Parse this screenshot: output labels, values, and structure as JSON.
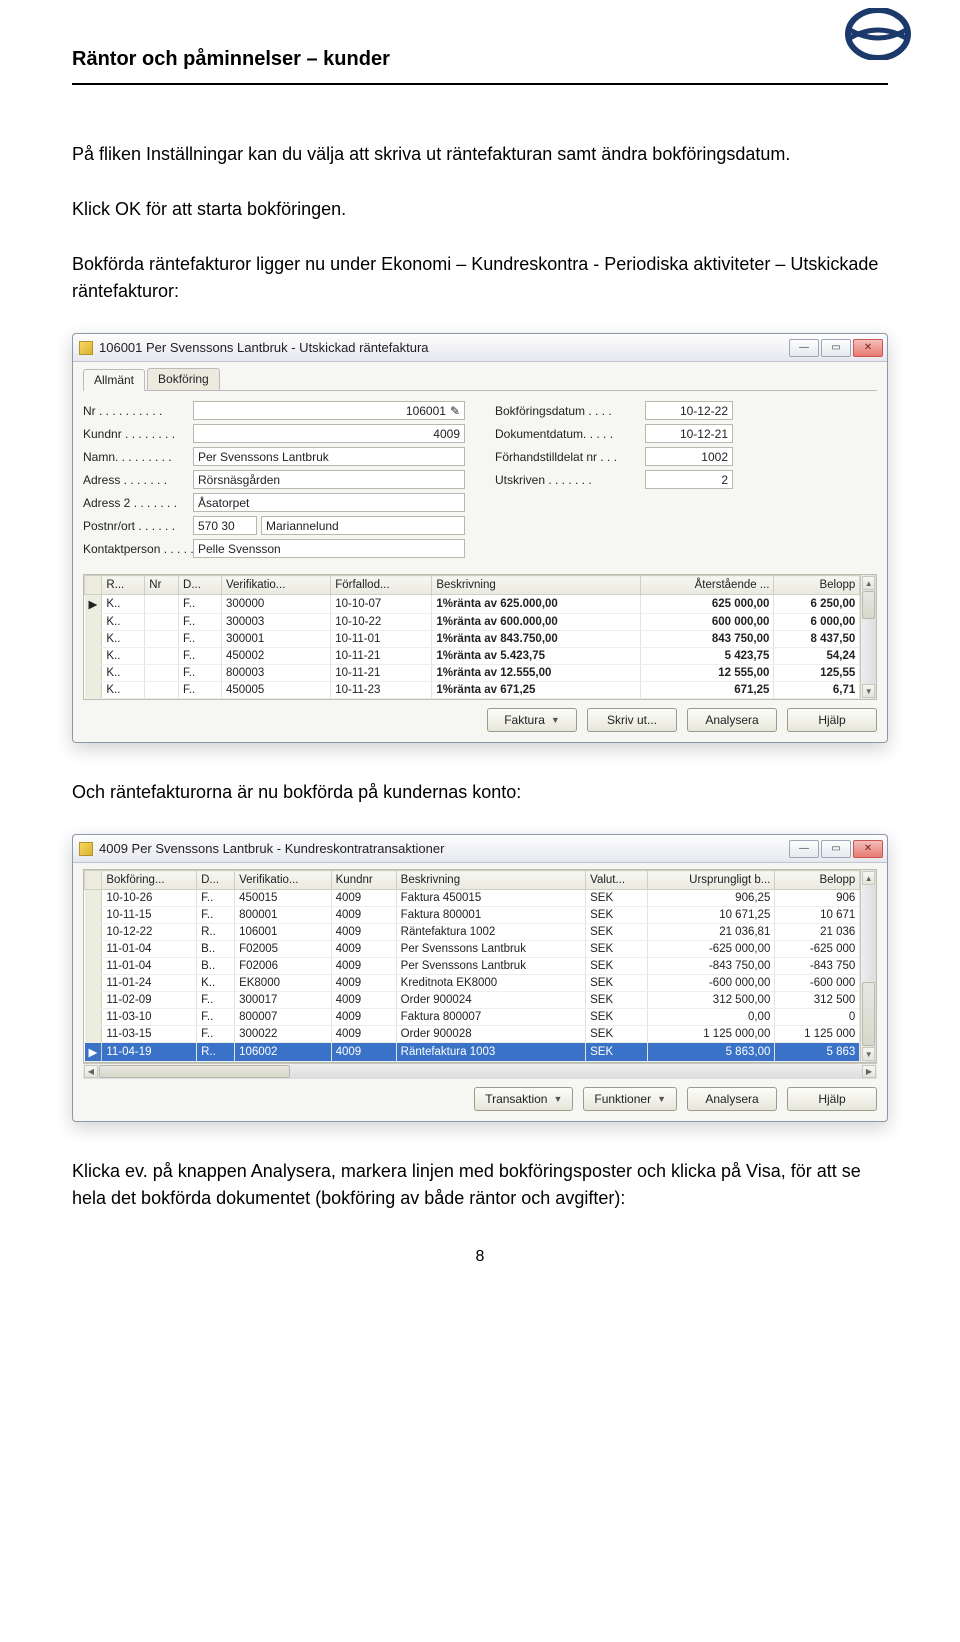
{
  "header": {
    "title": "Räntor och påminnelser – kunder"
  },
  "paragraphs": {
    "p1": "På fliken Inställningar kan du välja att skriva ut räntefakturan samt ändra bokföringsdatum.",
    "p2": "Klick OK för att starta bokföringen.",
    "p3": "Bokförda räntefakturor ligger nu under Ekonomi – Kundreskontra - Periodiska aktiviteter – Utskickade räntefakturor:",
    "p4": "Och räntefakturorna är nu bokförda på kundernas konto:",
    "p5": "Klicka ev. på knappen Analysera, markera linjen med bokföringsposter och klicka på Visa, för att se hela det bokförda dokumentet (bokföring av både räntor och avgifter):"
  },
  "win1": {
    "title": "106001 Per Svenssons Lantbruk - Utskickad räntefaktura",
    "tabs": {
      "t1": "Allmänt",
      "t2": "Bokföring"
    },
    "left": {
      "nr_label": "Nr . . . . . . . . . .",
      "nr_value": "106001",
      "kundnr_label": "Kundnr . . . . . . . .",
      "kundnr_value": "4009",
      "namn_label": "Namn. . . . . . . . .",
      "namn_value": "Per Svenssons Lantbruk",
      "adress_label": "Adress  . . . . . . .",
      "adress_value": "Rörsnäsgården",
      "adress2_label": "Adress 2 . . . . . . .",
      "adress2_value": "Åsatorpet",
      "postnr_label": "Postnr/ort  . . . . . .",
      "postnr_value": "570 30",
      "ort_value": "Mariannelund",
      "kontakt_label": "Kontaktperson . . . . .",
      "kontakt_value": "Pelle Svensson"
    },
    "right": {
      "bokf_label": "Bokföringsdatum . . . .",
      "bokf_value": "10-12-22",
      "dok_label": "Dokumentdatum. . . . .",
      "dok_value": "10-12-21",
      "forh_label": "Förhandstilldelat nr . . .",
      "forh_value": "1002",
      "utskr_label": "Utskriven . . . . . . .",
      "utskr_value": "2"
    },
    "gridhead": {
      "c0": "",
      "c1": "R...",
      "c2": "Nr",
      "c3": "D...",
      "c4": "Verifikatio...",
      "c5": "Förfallod...",
      "c6": "Beskrivning",
      "c7": "Återstående ...",
      "c8": "Belopp"
    },
    "rows": [
      {
        "r": "K..",
        "nr": "",
        "d": "F..",
        "ver": "300000",
        "forf": "10-10-07",
        "besk": "1%ränta av 625.000,00",
        "ater": "625 000,00",
        "bel": "6 250,00"
      },
      {
        "r": "K..",
        "nr": "",
        "d": "F..",
        "ver": "300003",
        "forf": "10-10-22",
        "besk": "1%ränta av 600.000,00",
        "ater": "600 000,00",
        "bel": "6 000,00"
      },
      {
        "r": "K..",
        "nr": "",
        "d": "F..",
        "ver": "300001",
        "forf": "10-11-01",
        "besk": "1%ränta av 843.750,00",
        "ater": "843 750,00",
        "bel": "8 437,50"
      },
      {
        "r": "K..",
        "nr": "",
        "d": "F..",
        "ver": "450002",
        "forf": "10-11-21",
        "besk": "1%ränta av 5.423,75",
        "ater": "5 423,75",
        "bel": "54,24"
      },
      {
        "r": "K..",
        "nr": "",
        "d": "F..",
        "ver": "800003",
        "forf": "10-11-21",
        "besk": "1%ränta av 12.555,00",
        "ater": "12 555,00",
        "bel": "125,55"
      },
      {
        "r": "K..",
        "nr": "",
        "d": "F..",
        "ver": "450005",
        "forf": "10-11-23",
        "besk": "1%ränta av 671,25",
        "ater": "671,25",
        "bel": "6,71"
      }
    ],
    "buttons": {
      "b1": "Faktura",
      "b2": "Skriv ut...",
      "b3": "Analysera",
      "b4": "Hjälp"
    }
  },
  "win2": {
    "title": "4009 Per Svenssons Lantbruk - Kundreskontratransaktioner",
    "gridhead": {
      "c0": "",
      "c1": "Bokföring...",
      "c2": "D...",
      "c3": "Verifikatio...",
      "c4": "Kundnr",
      "c5": "Beskrivning",
      "c6": "Valut...",
      "c7": "Ursprungligt b...",
      "c8": "Belopp"
    },
    "rows": [
      {
        "b": "10-10-26",
        "d": "F..",
        "v": "450015",
        "k": "4009",
        "be": "Faktura 450015",
        "va": "SEK",
        "u": "906,25",
        "bel": "906"
      },
      {
        "b": "10-11-15",
        "d": "F..",
        "v": "800001",
        "k": "4009",
        "be": "Faktura 800001",
        "va": "SEK",
        "u": "10 671,25",
        "bel": "10 671"
      },
      {
        "b": "10-12-22",
        "d": "R..",
        "v": "106001",
        "k": "4009",
        "be": "Räntefaktura 1002",
        "va": "SEK",
        "u": "21 036,81",
        "bel": "21 036"
      },
      {
        "b": "11-01-04",
        "d": "B..",
        "v": "F02005",
        "k": "4009",
        "be": "Per Svenssons Lantbruk",
        "va": "SEK",
        "u": "-625 000,00",
        "bel": "-625 000"
      },
      {
        "b": "11-01-04",
        "d": "B..",
        "v": "F02006",
        "k": "4009",
        "be": "Per Svenssons Lantbruk",
        "va": "SEK",
        "u": "-843 750,00",
        "bel": "-843 750"
      },
      {
        "b": "11-01-24",
        "d": "K..",
        "v": "EK8000",
        "k": "4009",
        "be": "Kreditnota EK8000",
        "va": "SEK",
        "u": "-600 000,00",
        "bel": "-600 000"
      },
      {
        "b": "11-02-09",
        "d": "F..",
        "v": "300017",
        "k": "4009",
        "be": "Order 900024",
        "va": "SEK",
        "u": "312 500,00",
        "bel": "312 500"
      },
      {
        "b": "11-03-10",
        "d": "F..",
        "v": "800007",
        "k": "4009",
        "be": "Faktura 800007",
        "va": "SEK",
        "u": "0,00",
        "bel": "0"
      },
      {
        "b": "11-03-15",
        "d": "F..",
        "v": "300022",
        "k": "4009",
        "be": "Order 900028",
        "va": "SEK",
        "u": "1 125 000,00",
        "bel": "1 125 000"
      },
      {
        "b": "11-04-19",
        "d": "R..",
        "v": "106002",
        "k": "4009",
        "be": "Räntefaktura 1003",
        "va": "SEK",
        "u": "5 863,00",
        "bel": "5 863",
        "sel": true
      }
    ],
    "buttons": {
      "b1": "Transaktion",
      "b2": "Funktioner",
      "b3": "Analysera",
      "b4": "Hjälp"
    }
  },
  "page_number": "8"
}
